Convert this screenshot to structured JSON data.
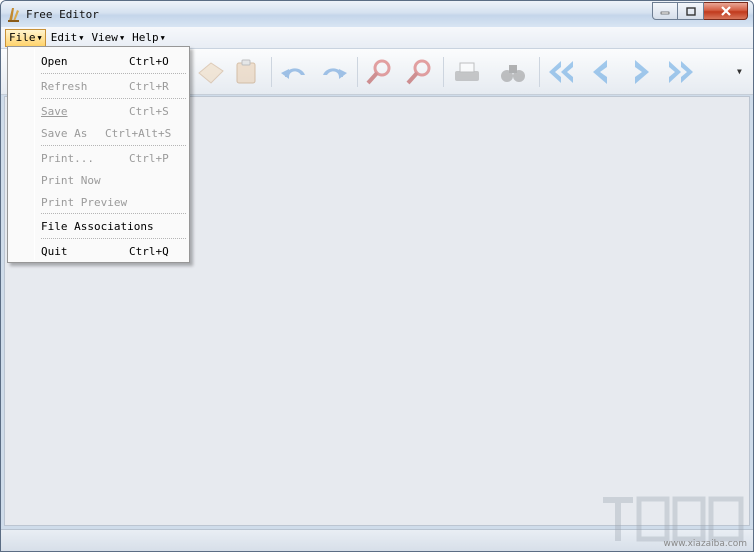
{
  "window": {
    "title": "Free Editor"
  },
  "menubar": {
    "items": [
      {
        "label": "File",
        "active": true
      },
      {
        "label": "Edit",
        "active": false
      },
      {
        "label": "View",
        "active": false
      },
      {
        "label": "Help",
        "active": false
      }
    ]
  },
  "file_menu": {
    "items": [
      {
        "label": "Open",
        "underline": "O",
        "shortcut": "Ctrl+O",
        "enabled": true
      },
      {
        "label": "Refresh",
        "underline": "R",
        "shortcut": "Ctrl+R",
        "enabled": false
      },
      {
        "label": "Save",
        "underline": "S",
        "shortcut": "Ctrl+S",
        "enabled": false
      },
      {
        "label": "Save As",
        "underline": "A",
        "shortcut": "Ctrl+Alt+S",
        "enabled": false
      },
      {
        "label": "Print...",
        "underline": "",
        "shortcut": "Ctrl+P",
        "enabled": false
      },
      {
        "label": "Print Now",
        "underline": "",
        "shortcut": "",
        "enabled": false
      },
      {
        "label": "Print Preview",
        "underline": "",
        "shortcut": "",
        "enabled": false
      },
      {
        "label": "File Associations",
        "underline": "",
        "shortcut": "",
        "enabled": true
      },
      {
        "label": "Quit",
        "underline": "Q",
        "shortcut": "Ctrl+Q",
        "enabled": true
      }
    ]
  },
  "toolbar": {
    "icons": [
      "clear-icon",
      "paste-icon",
      "undo-icon",
      "redo-icon",
      "find-icon",
      "find-next-icon",
      "print-icon",
      "binoculars-icon",
      "first-page-icon",
      "previous-icon",
      "next-icon",
      "last-page-icon"
    ]
  },
  "watermark": {
    "url": "www.xiazaiba.com"
  },
  "colors": {
    "accent": "#ffd36b",
    "workspace": "#e7eaef",
    "close_button": "#c13a1d"
  }
}
